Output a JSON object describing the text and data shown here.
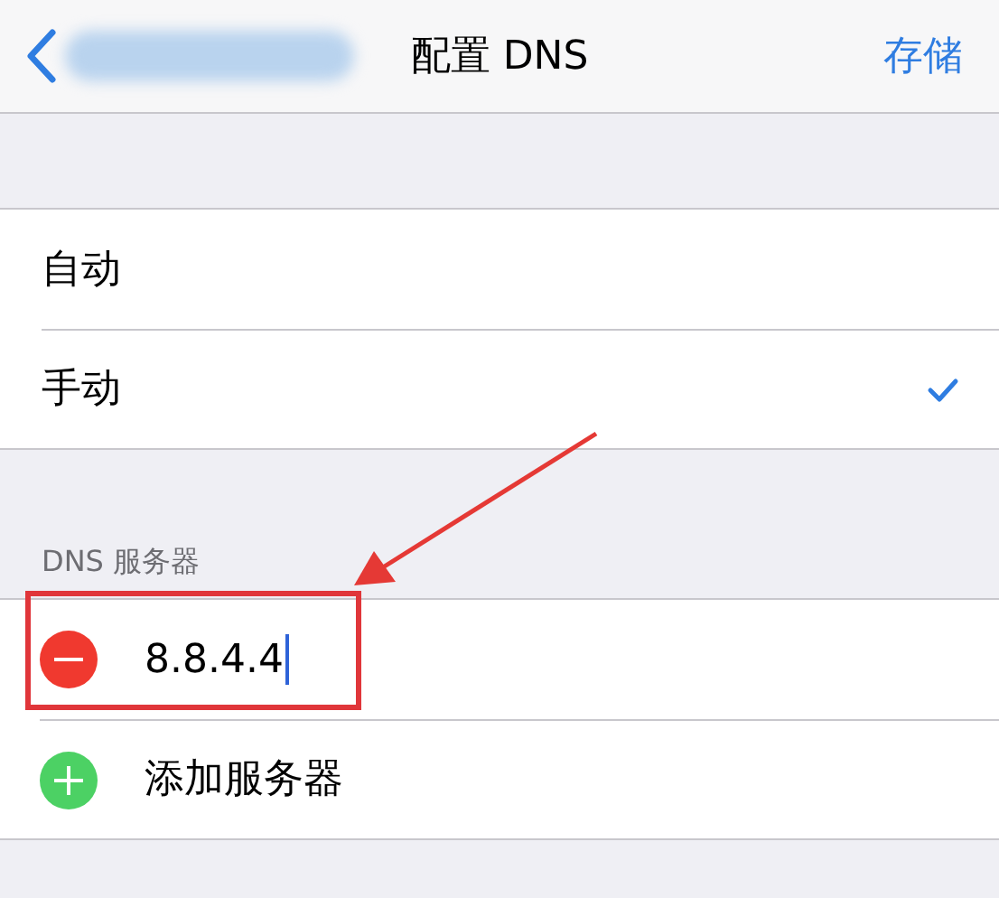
{
  "nav": {
    "title": "配置 DNS",
    "action": "存储"
  },
  "options": [
    {
      "label": "自动",
      "selected": false
    },
    {
      "label": "手动",
      "selected": true
    }
  ],
  "dns_section": {
    "header": "DNS 服务器",
    "servers": [
      {
        "value": "8.8.4.4",
        "focused": true
      }
    ],
    "add_label": "添加服务器"
  },
  "annotation": {
    "highlight": true
  }
}
